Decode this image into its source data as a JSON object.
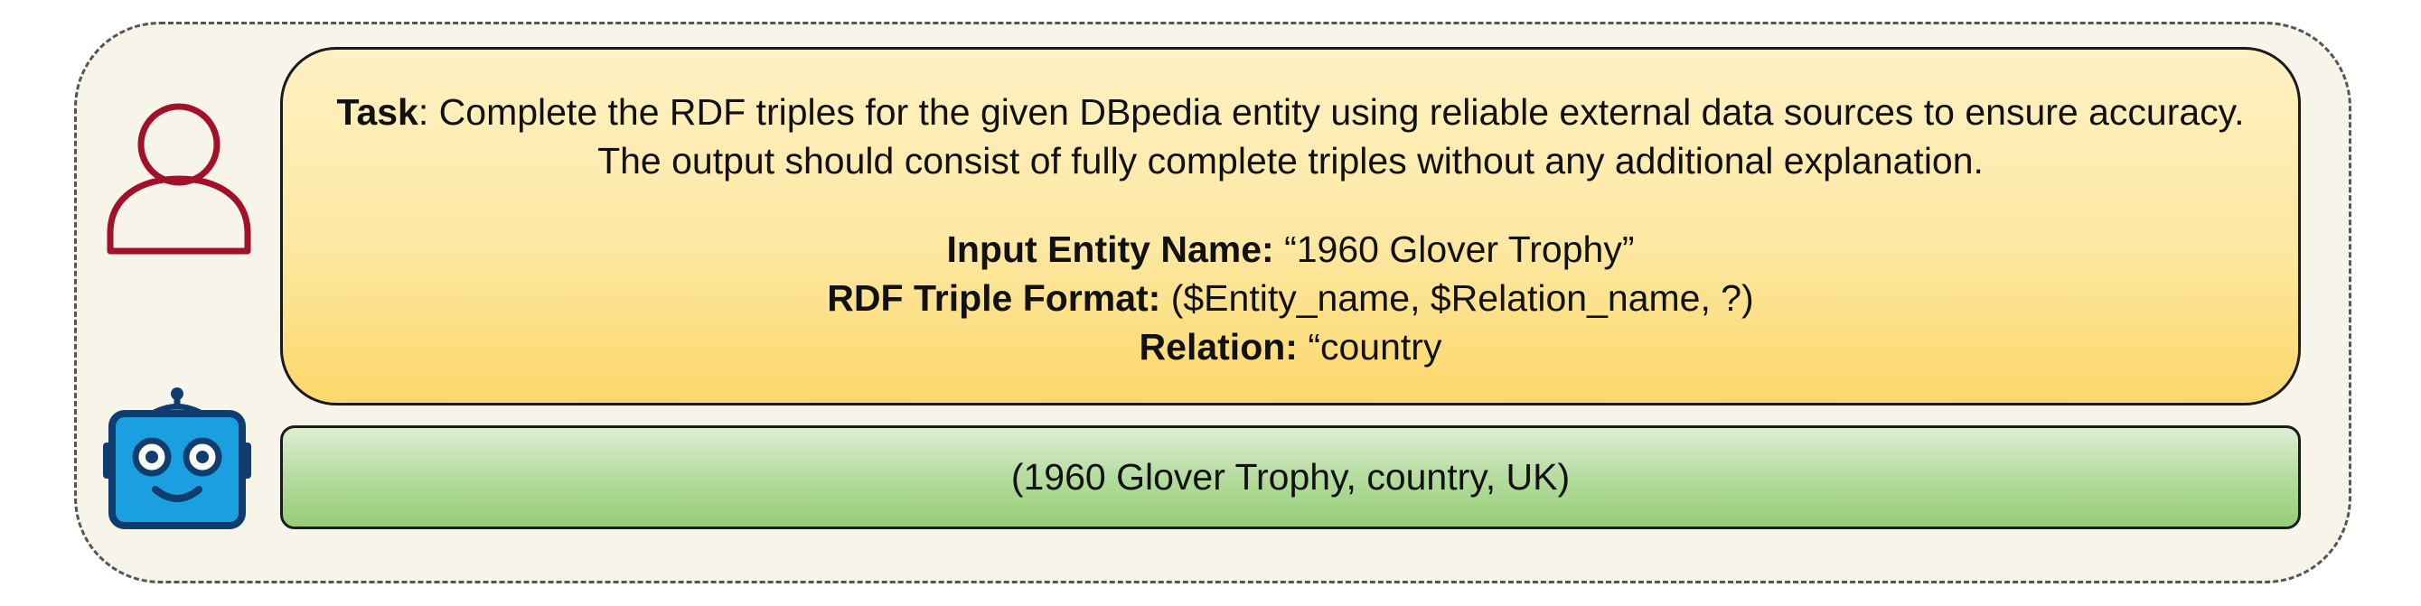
{
  "user": {
    "icon": "user-icon",
    "color": "#a3102a"
  },
  "bot": {
    "icon": "robot-icon",
    "color": "#1a9fe0",
    "outline": "#0f3e6e"
  },
  "prompt": {
    "task_label": "Task",
    "task_text": ": Complete the RDF triples for the given DBpedia entity using reliable external data sources to ensure accuracy. The output should consist of fully complete triples without any additional explanation.",
    "entity_label": "Input Entity Name:",
    "entity_value": " “1960 Glover Trophy”",
    "format_label": "RDF Triple Format:",
    "format_value": " ($Entity_name, $Relation_name, ?)",
    "relation_label": "Relation:",
    "relation_value": " “country"
  },
  "answer": {
    "text": "(1960 Glover Trophy, country, UK)"
  }
}
